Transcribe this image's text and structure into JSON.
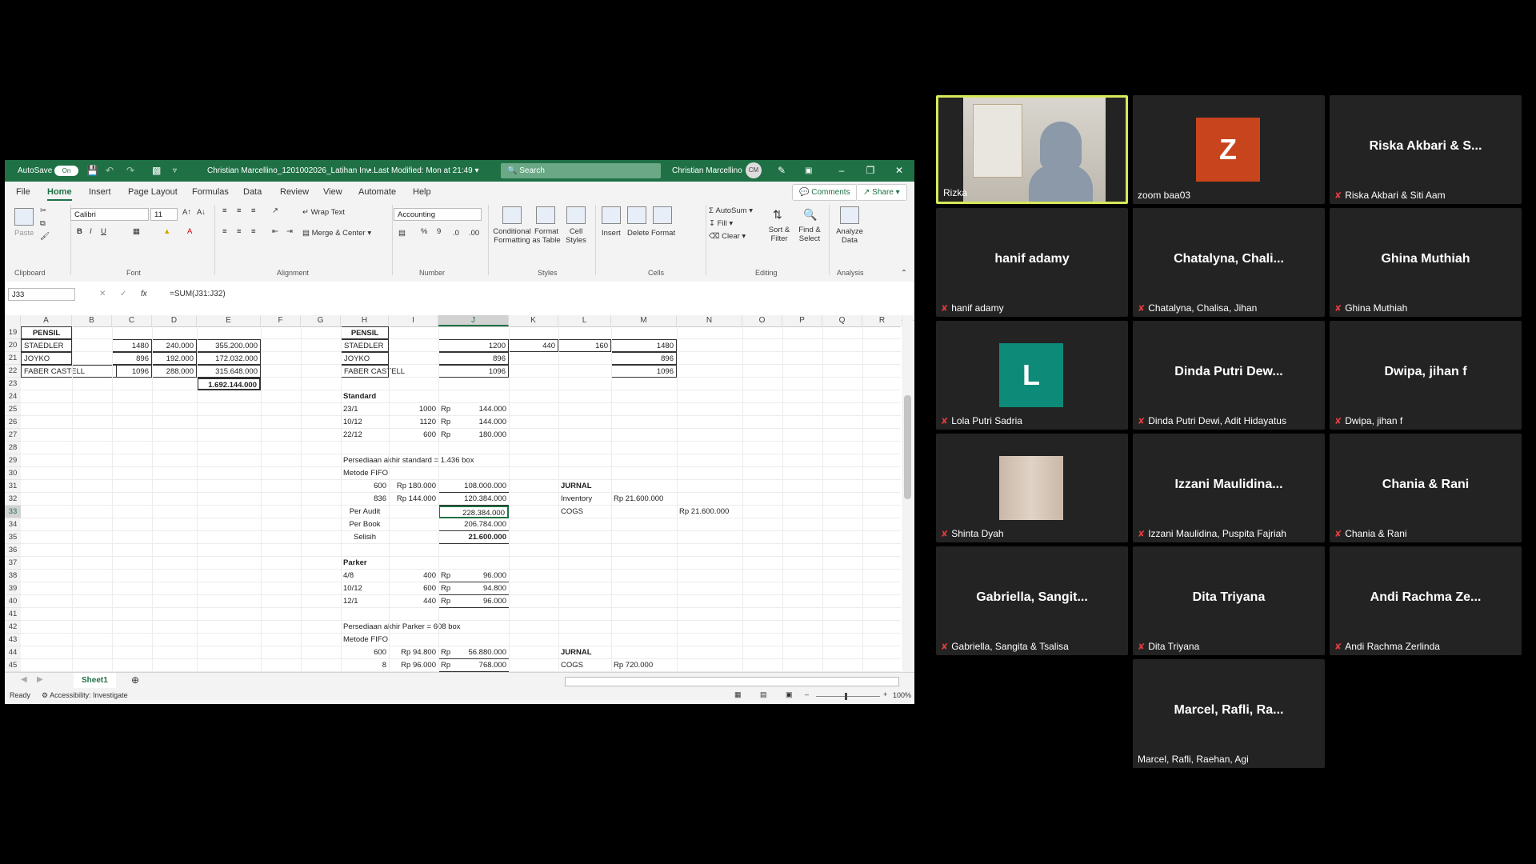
{
  "excel": {
    "autosave_label": "AutoSave",
    "autosave_state": "On",
    "filename": "Christian Marcellino_1201002026_Latihan Inv...",
    "modified": "• Last Modified: Mon at 21:49",
    "search_placeholder": "Search",
    "user_name": "Christian Marcellino",
    "user_initials": "CM",
    "menu": [
      "File",
      "Home",
      "Insert",
      "Page Layout",
      "Formulas",
      "Data",
      "Review",
      "View",
      "Automate",
      "Help"
    ],
    "comments_label": "Comments",
    "share_label": "Share",
    "ribbon": {
      "paste": "Paste",
      "font_name": "Calibri",
      "font_size": "11",
      "wrap_text": "Wrap Text",
      "merge_center": "Merge & Center",
      "number_format": "Accounting",
      "conditional_formatting": "Conditional Formatting",
      "format_as_table": "Format as Table",
      "cell_styles": "Cell Styles",
      "insert": "Insert",
      "delete": "Delete",
      "format": "Format",
      "autosum": "AutoSum",
      "fill": "Fill",
      "clear": "Clear",
      "sort_filter": "Sort & Filter",
      "find_select": "Find & Select",
      "analyze_data": "Analyze Data",
      "groups": [
        "Clipboard",
        "Font",
        "Alignment",
        "Number",
        "Styles",
        "Cells",
        "Editing",
        "Analysis"
      ]
    },
    "name_box": "J33",
    "formula": "=SUM(J31:J32)",
    "columns": [
      "A",
      "B",
      "C",
      "D",
      "E",
      "F",
      "G",
      "H",
      "I",
      "J",
      "K",
      "L",
      "M",
      "N",
      "O",
      "P",
      "Q",
      "R"
    ],
    "selected_column": "J",
    "selected_row": "33",
    "rows": [
      {
        "n": "19",
        "cells": {
          "A": "PENSIL",
          "H": "PENSIL"
        }
      },
      {
        "n": "20",
        "cells": {
          "A": "STAEDLER",
          "C": "1480",
          "D": "240.000",
          "E": "355.200.000",
          "H": "STAEDLER",
          "J": "1200",
          "K": "440",
          "L": "160",
          "M": "1480"
        }
      },
      {
        "n": "21",
        "cells": {
          "A": "JOYKO",
          "C": "896",
          "D": "192.000",
          "E": "172.032.000",
          "H": "JOYKO",
          "J": "896",
          "M": "896"
        }
      },
      {
        "n": "22",
        "cells": {
          "A": "FABER CASTELL",
          "C": "1096",
          "D": "288.000",
          "E": "315.648.000",
          "H": "FABER CASTELL",
          "J": "1096",
          "M": "1096"
        }
      },
      {
        "n": "23",
        "cells": {
          "E": "1.692.144.000"
        }
      },
      {
        "n": "24",
        "cells": {
          "H": "Standard"
        }
      },
      {
        "n": "25",
        "cells": {
          "H": "23/1",
          "I": "1000",
          "Ip": "Rp",
          "J": "144.000"
        }
      },
      {
        "n": "26",
        "cells": {
          "H": "10/12",
          "I": "1120",
          "Ip": "Rp",
          "J": "144.000"
        }
      },
      {
        "n": "27",
        "cells": {
          "H": "22/12",
          "I": "600",
          "Ip": "Rp",
          "J": "180.000"
        }
      },
      {
        "n": "28",
        "cells": {}
      },
      {
        "n": "29",
        "cells": {
          "H": "Persediaan akhir standard = 1.436 box"
        }
      },
      {
        "n": "30",
        "cells": {
          "H": "Metode FIFO"
        }
      },
      {
        "n": "31",
        "cells": {
          "Hr": "600",
          "I": "Rp 180.000",
          "J": "108.000.000",
          "L": "JURNAL"
        }
      },
      {
        "n": "32",
        "cells": {
          "Hr": "836",
          "I": "Rp 144.000",
          "J": "120.384.000",
          "L": "Inventory",
          "M": "Rp   21.600.000"
        }
      },
      {
        "n": "33",
        "cells": {
          "Hc": "Per Audit",
          "J": "228.384.000",
          "L": "   COGS",
          "N": "Rp   21.600.000"
        }
      },
      {
        "n": "34",
        "cells": {
          "Hc": "Per Book",
          "J": "206.784.000"
        }
      },
      {
        "n": "35",
        "cells": {
          "Hc": "Selisih",
          "J": "21.600.000"
        }
      },
      {
        "n": "36",
        "cells": {}
      },
      {
        "n": "37",
        "cells": {
          "H": "Parker"
        }
      },
      {
        "n": "38",
        "cells": {
          "H": "4/8",
          "I": "400",
          "Ip": "Rp",
          "J": "96.000"
        }
      },
      {
        "n": "39",
        "cells": {
          "H": "10/12",
          "I": "600",
          "Ip": "Rp",
          "J": "94.800"
        }
      },
      {
        "n": "40",
        "cells": {
          "H": "12/1",
          "I": "440",
          "Ip": "Rp",
          "J": "96.000"
        }
      },
      {
        "n": "41",
        "cells": {}
      },
      {
        "n": "42",
        "cells": {
          "H": "Persediaan akhir Parker = 608 box"
        }
      },
      {
        "n": "43",
        "cells": {
          "H": "Metode FIFO"
        }
      },
      {
        "n": "44",
        "cells": {
          "Hr": "600",
          "I": "Rp  94.800",
          "Ip": "Rp",
          "J": "56.880.000",
          "L": "JURNAL"
        }
      },
      {
        "n": "45",
        "cells": {
          "Hr": "8",
          "I": "Rp  96.000",
          "Ip": "Rp",
          "J": "768.000",
          "L": "COGS",
          "M": "Rp      720.000"
        }
      }
    ],
    "sheet_tab": "Sheet1",
    "status_ready": "Ready",
    "accessibility": "Accessibility: Investigate",
    "zoom": "100%"
  },
  "participants": [
    {
      "display": "",
      "label": "Rizka",
      "muted": false,
      "kind": "video"
    },
    {
      "display": "Z",
      "label": "zoom baa03",
      "muted": false,
      "kind": "letter",
      "color": "#c8441d"
    },
    {
      "display": "Riska Akbari & S...",
      "label": "Riska Akbari & Siti Aam",
      "muted": true,
      "kind": "name"
    },
    {
      "display": "hanif adamy",
      "label": "hanif adamy",
      "muted": true,
      "kind": "name"
    },
    {
      "display": "Chatalyna,  Chali...",
      "label": "Chatalyna, Chalisa, Jihan",
      "muted": true,
      "kind": "name"
    },
    {
      "display": "Ghina Muthiah",
      "label": "Ghina Muthiah",
      "muted": true,
      "kind": "name"
    },
    {
      "display": "L",
      "label": "Lola Putri Sadria",
      "muted": true,
      "kind": "letter",
      "color": "#0e8a78"
    },
    {
      "display": "Dinda Putri Dew...",
      "label": "Dinda Putri Dewi, Adit Hidayatus",
      "muted": true,
      "kind": "name"
    },
    {
      "display": "Dwipa, jihan f",
      "label": "Dwipa, jihan f",
      "muted": true,
      "kind": "name"
    },
    {
      "display": "",
      "label": "Shinta Dyah",
      "muted": true,
      "kind": "photo"
    },
    {
      "display": "Izzani  Maulidina...",
      "label": "Izzani Maulidina, Puspita Fajriah",
      "muted": true,
      "kind": "name"
    },
    {
      "display": "Chania & Rani",
      "label": "Chania & Rani",
      "muted": true,
      "kind": "name"
    },
    {
      "display": "Gabriella,  Sangit...",
      "label": "Gabriella, Sangita & Tsalisa",
      "muted": true,
      "kind": "name"
    },
    {
      "display": "Dita Triyana",
      "label": "Dita Triyana",
      "muted": true,
      "kind": "name"
    },
    {
      "display": "Andi Rachma Ze...",
      "label": "Andi Rachma Zerlinda",
      "muted": true,
      "kind": "name"
    },
    {
      "display": "Marcel,  Rafli,  Ra...",
      "label": "Marcel, Rafli, Raehan, Agi",
      "muted": false,
      "kind": "name"
    }
  ]
}
